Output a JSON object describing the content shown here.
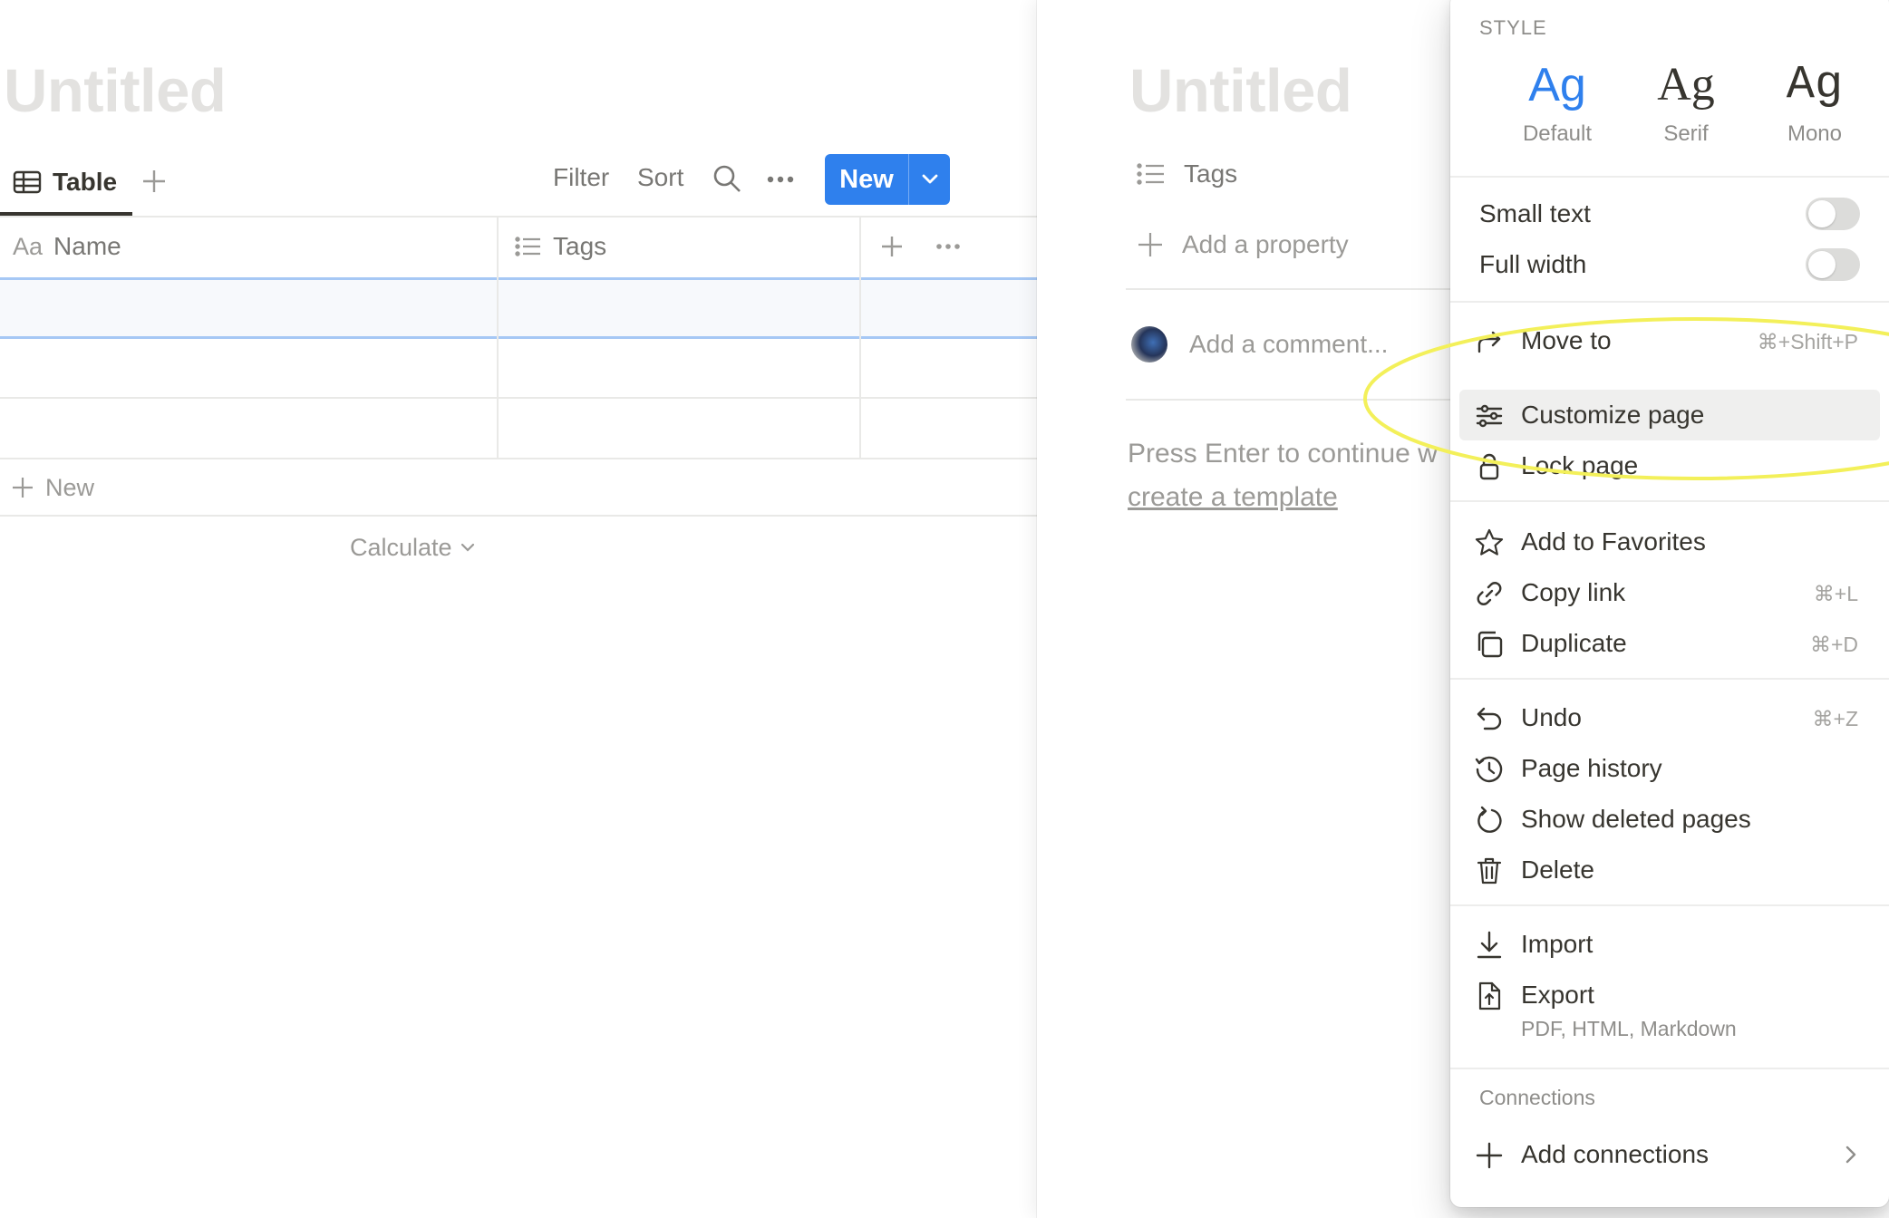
{
  "left_page": {
    "title": "Untitled",
    "view_tab": {
      "label": "Table",
      "icon": "table-icon"
    },
    "toolbar": {
      "filter_label": "Filter",
      "sort_label": "Sort",
      "search_icon": "search-icon",
      "more_icon": "more-horizontal-icon",
      "new_label": "New",
      "new_caret_icon": "chevron-down-icon",
      "accent_color": "#2f80ed"
    },
    "table": {
      "columns": [
        {
          "prefix": "Aa",
          "label": "Name"
        },
        {
          "icon": "list-icon",
          "label": "Tags"
        }
      ],
      "rows": [
        {
          "name": "",
          "tags": "",
          "selected": true
        },
        {
          "name": "",
          "tags": ""
        },
        {
          "name": "",
          "tags": ""
        }
      ],
      "add_row_label": "New",
      "calculate_label": "Calculate"
    }
  },
  "peek_page": {
    "title": "Untitled",
    "property_tags_label": "Tags",
    "add_property_label": "Add a property",
    "comment_placeholder": "Add a comment...",
    "empty_hint": "Press Enter to continue w",
    "template_link": "create a template"
  },
  "menu": {
    "style_heading": "STYLE",
    "fonts": [
      {
        "sample": "Ag",
        "name": "Default",
        "selected": true
      },
      {
        "sample": "Ag",
        "name": "Serif"
      },
      {
        "sample": "Ag",
        "name": "Mono"
      }
    ],
    "toggles": [
      {
        "label": "Small text",
        "on": false
      },
      {
        "label": "Full width",
        "on": false
      }
    ],
    "items": {
      "move_to": {
        "label": "Move to",
        "shortcut": "⌘+Shift+P",
        "icon": "move-arrow-icon"
      },
      "customize_page": {
        "label": "Customize page",
        "icon": "sliders-icon",
        "highlighted": true
      },
      "lock_page": {
        "label": "Lock page",
        "icon": "lock-icon"
      },
      "add_favorites": {
        "label": "Add to Favorites",
        "icon": "star-icon"
      },
      "copy_link": {
        "label": "Copy link",
        "shortcut": "⌘+L",
        "icon": "link-icon"
      },
      "duplicate": {
        "label": "Duplicate",
        "shortcut": "⌘+D",
        "icon": "duplicate-icon"
      },
      "undo": {
        "label": "Undo",
        "shortcut": "⌘+Z",
        "icon": "undo-icon"
      },
      "page_history": {
        "label": "Page history",
        "icon": "history-icon"
      },
      "show_deleted": {
        "label": "Show deleted pages",
        "icon": "restore-icon"
      },
      "delete": {
        "label": "Delete",
        "icon": "trash-icon"
      },
      "import": {
        "label": "Import",
        "icon": "import-icon"
      },
      "export": {
        "label": "Export",
        "sublabel": "PDF, HTML, Markdown",
        "icon": "export-file-icon"
      }
    },
    "connections_heading": "Connections",
    "add_connections": {
      "label": "Add connections",
      "icon": "plus-icon"
    }
  },
  "annotation": {
    "shape": "ellipse",
    "color": "#f3f05a"
  }
}
